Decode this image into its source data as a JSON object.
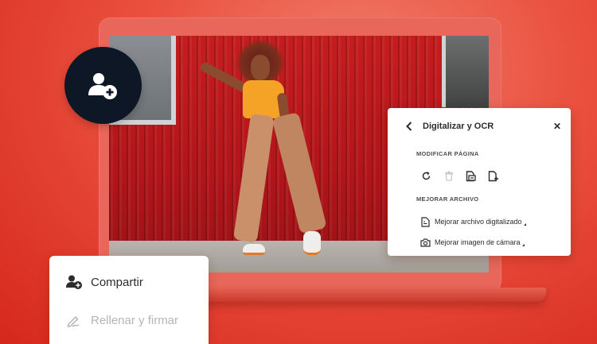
{
  "avatar_button": {
    "icon": "add-user-icon"
  },
  "scan_panel": {
    "title": "Digitalizar y OCR",
    "back_icon": "chevron-left-icon",
    "close_icon": "close-icon",
    "close_glyph": "✕",
    "section_modify": "MODIFICAR PÁGINA",
    "tools": [
      {
        "icon": "rotate-icon",
        "enabled": true
      },
      {
        "icon": "delete-icon",
        "enabled": false
      },
      {
        "icon": "replace-page-icon",
        "enabled": true
      },
      {
        "icon": "insert-page-icon",
        "enabled": true
      }
    ],
    "section_enhance": "MEJORAR ARCHIVO",
    "enhance_items": [
      {
        "label": "Mejorar archivo digitalizado",
        "icon": "scanned-file-icon"
      },
      {
        "label": "Mejorar imagen de cámara",
        "icon": "camera-icon"
      }
    ]
  },
  "menu": {
    "items": [
      {
        "label": "Compartir",
        "icon": "share-user-icon",
        "enabled": true
      },
      {
        "label": "Rellenar y firmar",
        "icon": "pen-sign-icon",
        "enabled": false
      }
    ]
  },
  "colors": {
    "background": "#ea4f3d",
    "laptop": "#e9665a",
    "avatar_bg": "#0e1726",
    "text_primary": "#2c2c2c",
    "text_disabled": "#b5b5b5"
  }
}
